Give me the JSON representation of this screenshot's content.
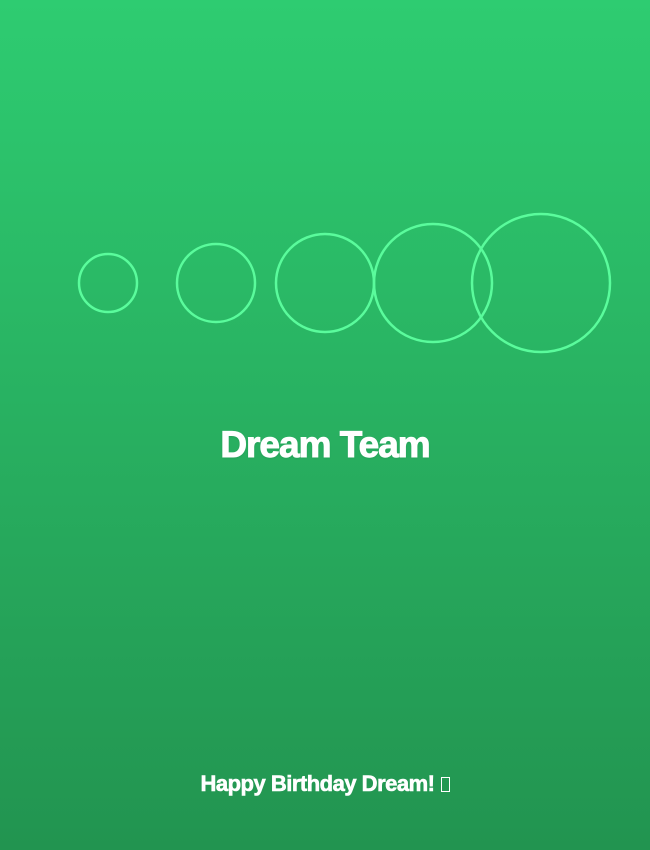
{
  "card": {
    "title": "Dream Team",
    "message": "Happy Birthday Dream!",
    "message_emoji_icon": "missing-glyph-icon",
    "colors": {
      "gradient_top": "#2ecc71",
      "gradient_bottom": "#229450",
      "ring_stroke": "#5dff9f",
      "text": "#ffffff"
    },
    "decorations": {
      "ring_count": 5,
      "icon": "ring-icon"
    }
  }
}
